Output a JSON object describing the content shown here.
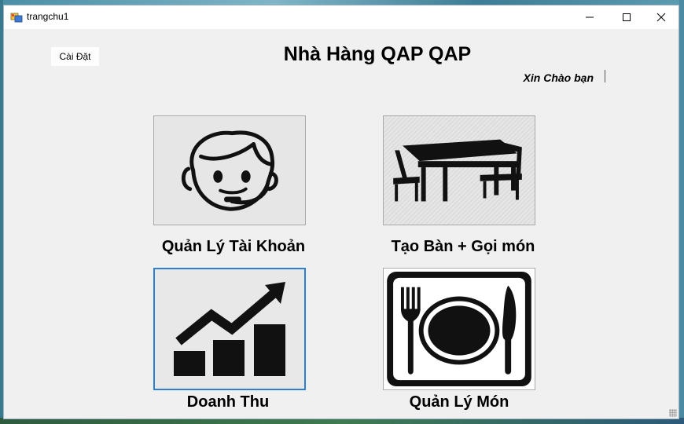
{
  "window": {
    "title": "trangchu1",
    "controls": {
      "minimize": "—",
      "maximize": "☐",
      "close": "✕"
    }
  },
  "toolbar": {
    "settings_label": "Cài Đặt"
  },
  "header": {
    "title": "Nhà Hàng QAP QAP",
    "greeting": "Xin Chào bạn"
  },
  "tiles": [
    {
      "label": "Quản Lý Tài Khoản",
      "icon": "headset-operator-icon"
    },
    {
      "label": "Tạo Bàn + Gọi món",
      "icon": "dining-table-icon"
    },
    {
      "label": "Doanh Thu",
      "icon": "revenue-chart-icon"
    },
    {
      "label": "Quản Lý Món",
      "icon": "plate-fork-knife-icon"
    }
  ],
  "colors": {
    "window_bg": "#f0f0f0",
    "focus_border": "#2d7fd0",
    "icon": "#000000"
  }
}
